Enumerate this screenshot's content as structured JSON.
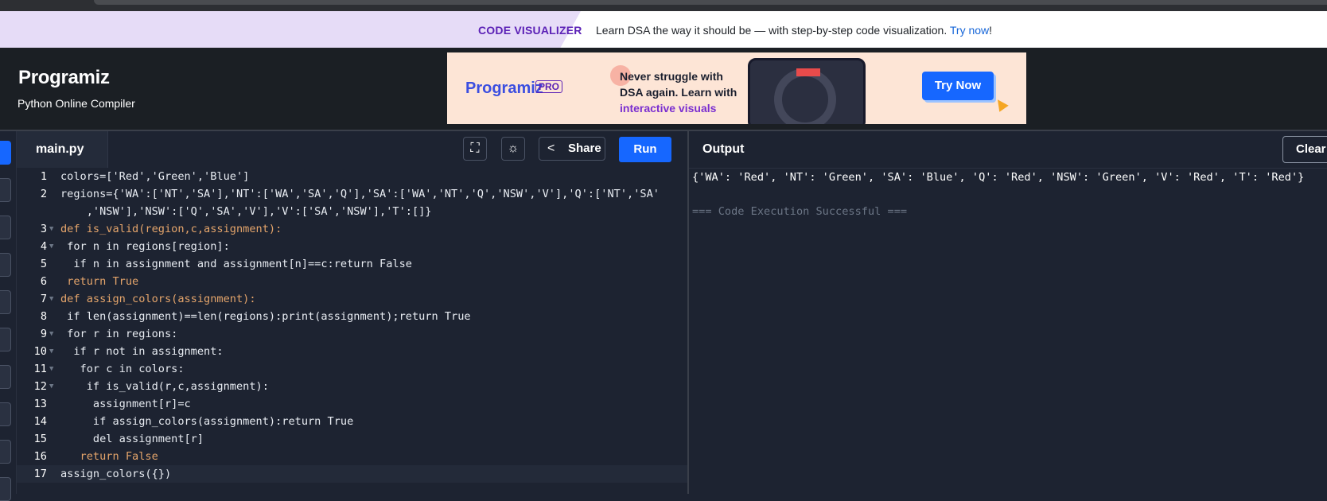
{
  "promo": {
    "badge": "CODE VISUALIZER",
    "message": "Learn DSA the way it should be — with step-by-step code visualization. ",
    "link": "Try now",
    "suffix": "!"
  },
  "header": {
    "logo": "Programiz",
    "subtitle": "Python Online Compiler"
  },
  "ad": {
    "logo": "Programiz",
    "pro": "PRO",
    "line1": "Never struggle with",
    "line2": "DSA again. Learn with",
    "line3": "interactive visuals",
    "button": "Try Now"
  },
  "editor": {
    "tab": "main.py",
    "share_label": "Share",
    "run_label": "Run"
  },
  "code": {
    "line_numbers": [
      "1",
      "2",
      "3",
      "4",
      "5",
      "6",
      "7",
      "8",
      "9",
      "10",
      "11",
      "12",
      "13",
      "14",
      "15",
      "16",
      "17"
    ],
    "l1": "colors=['Red','Green','Blue']",
    "l2a": "regions={'WA':['NT','SA'],'NT':['WA','SA','Q'],'SA':['WA','NT','Q','NSW','V'],'Q':['NT','SA'",
    "l2b": "    ,'NSW'],'NSW':['Q','SA','V'],'V':['SA','NSW'],'T':[]}",
    "l3": "def is_valid(region,c,assignment):",
    "l4": " for n in regions[region]:",
    "l5": "  if n in assignment and assignment[n]==c:return False",
    "l6": " return True",
    "l7": "def assign_colors(assignment):",
    "l8": " if len(assignment)==len(regions):print(assignment);return True",
    "l9": " for r in regions:",
    "l10": "  if r not in assignment:",
    "l11": "   for c in colors:",
    "l12": "    if is_valid(r,c,assignment):",
    "l13": "     assignment[r]=c",
    "l14": "     if assign_colors(assignment):return True",
    "l15": "     del assignment[r]",
    "l16": "   return False",
    "l17": "assign_colors({})"
  },
  "output": {
    "title": "Output",
    "clear_label": "Clear",
    "line1": "{'WA': 'Red', 'NT': 'Green', 'SA': 'Blue', 'Q': 'Red', 'NSW': 'Green', 'V': 'Red', 'T': 'Red'}",
    "line2": "=== Code Execution Successful ==="
  },
  "colors": {
    "accent": "#1667ff",
    "badge": "#5b21b6",
    "editor_bg": "#1d2331"
  }
}
